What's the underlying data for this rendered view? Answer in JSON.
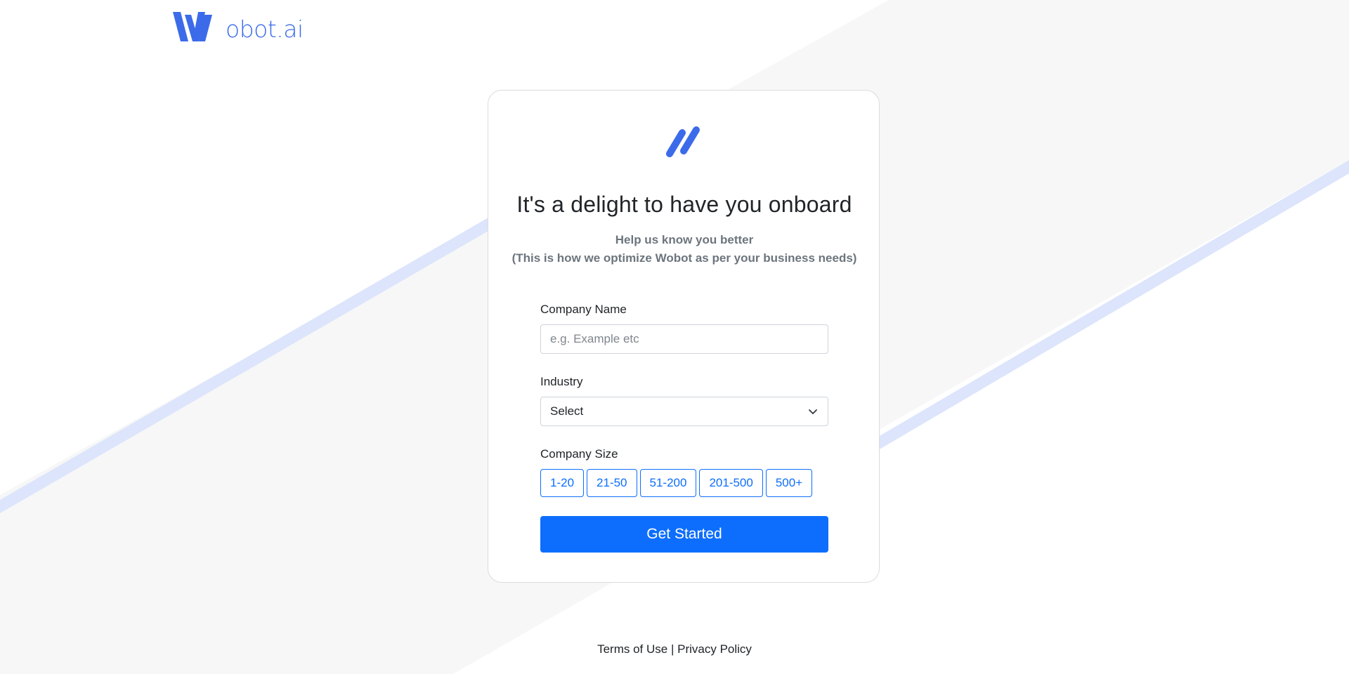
{
  "header": {
    "logo_text": "obot.ai",
    "brand_color": "#3c6bea"
  },
  "card": {
    "title": "It's a delight to have you onboard",
    "subtitle_line1": "Help us know you better",
    "subtitle_line2": "(This is how we optimize Wobot as per your business needs)"
  },
  "form": {
    "company_name": {
      "label": "Company Name",
      "value": "",
      "placeholder": "e.g. Example etc"
    },
    "industry": {
      "label": "Industry",
      "selected": "Select"
    },
    "company_size": {
      "label": "Company Size",
      "options": [
        "1-20",
        "21-50",
        "51-200",
        "201-500",
        "500+"
      ]
    },
    "submit_label": "Get Started",
    "accent_color": "#0d6efd"
  },
  "footer": {
    "terms": "Terms of Use",
    "separator": "|",
    "privacy": "Privacy Policy"
  }
}
